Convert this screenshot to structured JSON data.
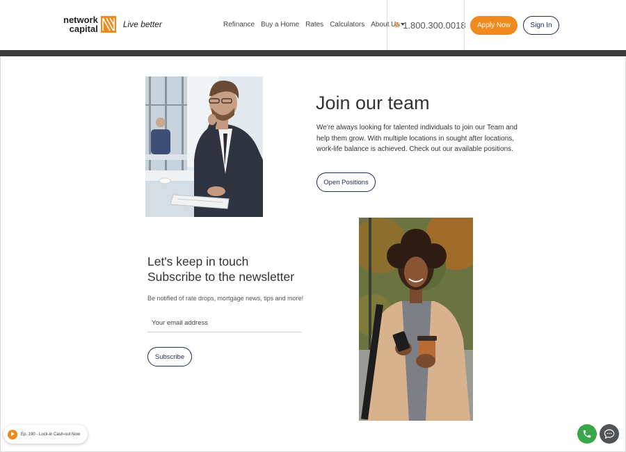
{
  "header": {
    "logo": {
      "line1": "network",
      "line2": "capital"
    },
    "tagline": "Live better",
    "nav": [
      {
        "label": "Refinance"
      },
      {
        "label": "Buy a Home"
      },
      {
        "label": "Rates"
      },
      {
        "label": "Calculators"
      },
      {
        "label": "About Us"
      }
    ],
    "phone": "1.800.300.0018",
    "apply_label": "Apply Now",
    "signin_label": "Sign In"
  },
  "join": {
    "title": "Join our team",
    "body": "We're always looking for talented individuals to join our Team and help them grow. With multiple locations in sought after locations, work-life balance is achieved. Check out our available positions.",
    "button_label": "Open Positions"
  },
  "newsletter": {
    "title_line1": "Let's keep in touch",
    "title_line2": "Subscribe to the newsletter",
    "note": "Be notified of rate drops, mortgage news, tips and more!",
    "email_placeholder": "Your email address",
    "button_label": "Subscribe"
  },
  "podcast": {
    "label": "Ep. 190 - Lock-in Cash-out Now"
  },
  "colors": {
    "accent": "#f08a1c",
    "navy": "#1f2a55",
    "bar": "#3b3b3b",
    "call": "#3aa64a",
    "chat": "#505457"
  },
  "icons": {
    "phone": "phone-icon",
    "play": "play-icon",
    "call": "call-icon",
    "chat": "chat-bubble-icon"
  }
}
